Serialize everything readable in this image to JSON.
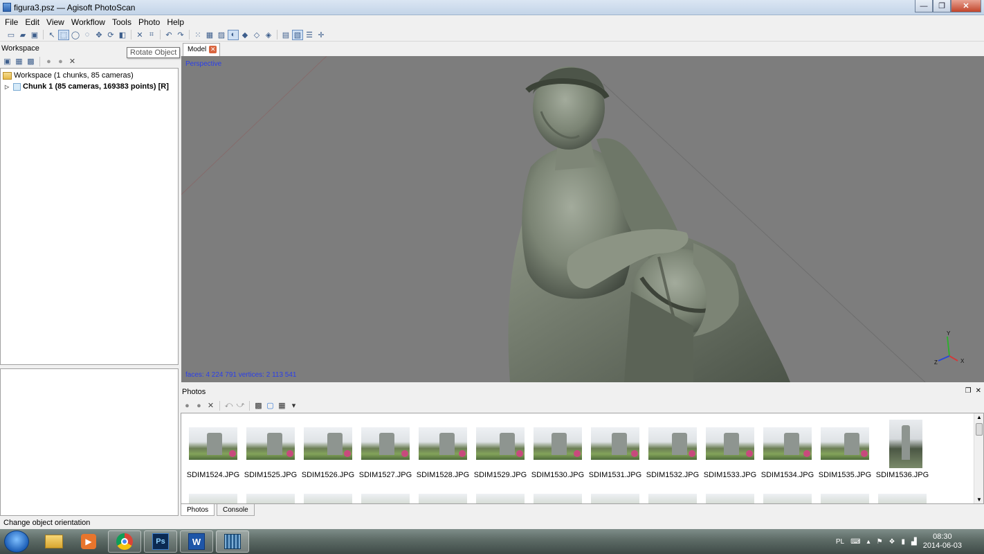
{
  "window": {
    "title": "figura3.psz — Agisoft PhotoScan",
    "controls": [
      "—",
      "❐",
      "✕"
    ]
  },
  "menu": [
    "File",
    "Edit",
    "View",
    "Workflow",
    "Tools",
    "Photo",
    "Help"
  ],
  "tooltip": "Rotate Object",
  "workspace": {
    "header": "Workspace",
    "root": "Workspace (1 chunks, 85 cameras)",
    "chunk": "Chunk 1 (85 cameras, 169383 points) [R]"
  },
  "model_tab": {
    "label": "Model",
    "close": "✕"
  },
  "viewport": {
    "projection": "Perspective",
    "stats": "faces: 4 224 791 vertices: 2 113 541",
    "axes": {
      "x": "X",
      "y": "Y",
      "z": "Z"
    },
    "background": "#7d7d7d"
  },
  "photos": {
    "header": "Photos",
    "files": [
      "SDIM1524.JPG",
      "SDIM1525.JPG",
      "SDIM1526.JPG",
      "SDIM1527.JPG",
      "SDIM1528.JPG",
      "SDIM1529.JPG",
      "SDIM1530.JPG",
      "SDIM1531.JPG",
      "SDIM1532.JPG",
      "SDIM1533.JPG",
      "SDIM1534.JPG",
      "SDIM1535.JPG",
      "SDIM1536.JPG"
    ],
    "tabs": [
      "Photos",
      "Console"
    ]
  },
  "status": "Change object orientation",
  "taskbar": {
    "apps": [
      "start-orb",
      "explorer",
      "media-player",
      "chrome",
      "photoshop",
      "word",
      "photoscan"
    ],
    "language": "PL",
    "time": "08:30",
    "date": "2014-06-03"
  }
}
